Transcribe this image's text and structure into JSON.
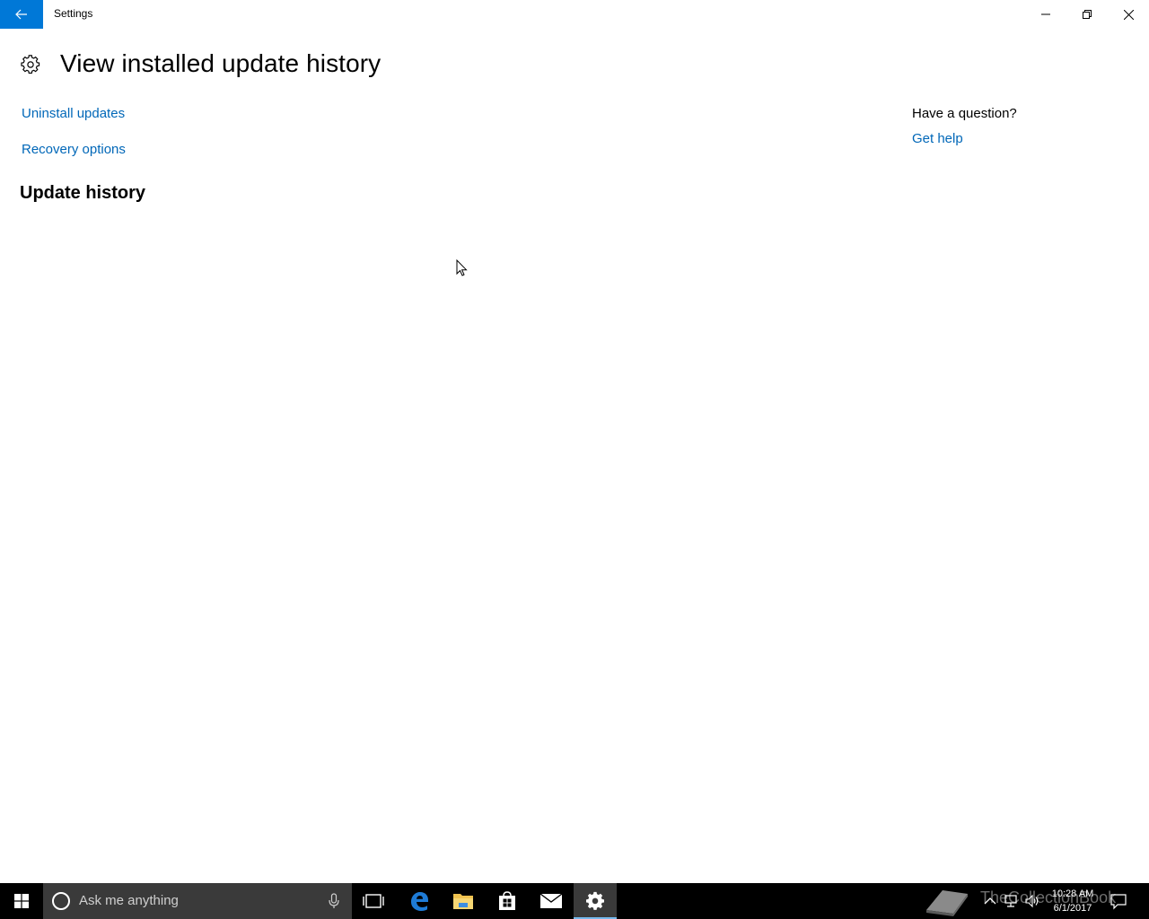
{
  "window": {
    "title": "Settings"
  },
  "page": {
    "title": "View installed update history",
    "links": {
      "uninstall_updates": "Uninstall updates",
      "recovery_options": "Recovery options"
    },
    "section_title": "Update history"
  },
  "help_panel": {
    "question": "Have a question?",
    "get_help": "Get help"
  },
  "taskbar": {
    "search_placeholder": "Ask me anything",
    "pinned_icons": [
      "task-view-icon",
      "edge-icon",
      "file-explorer-icon",
      "store-icon",
      "mail-icon",
      "settings-icon"
    ],
    "active_app": "settings-icon",
    "watermark": "TheCollectionBook",
    "clock_time": "10:28 AM",
    "clock_date": "6/1/2017"
  },
  "colors": {
    "accent": "#0078d7",
    "link": "#0067b8",
    "taskbar": "#000000",
    "taskbar_search": "#3a3a3a",
    "active_underline": "#76b9ed"
  }
}
